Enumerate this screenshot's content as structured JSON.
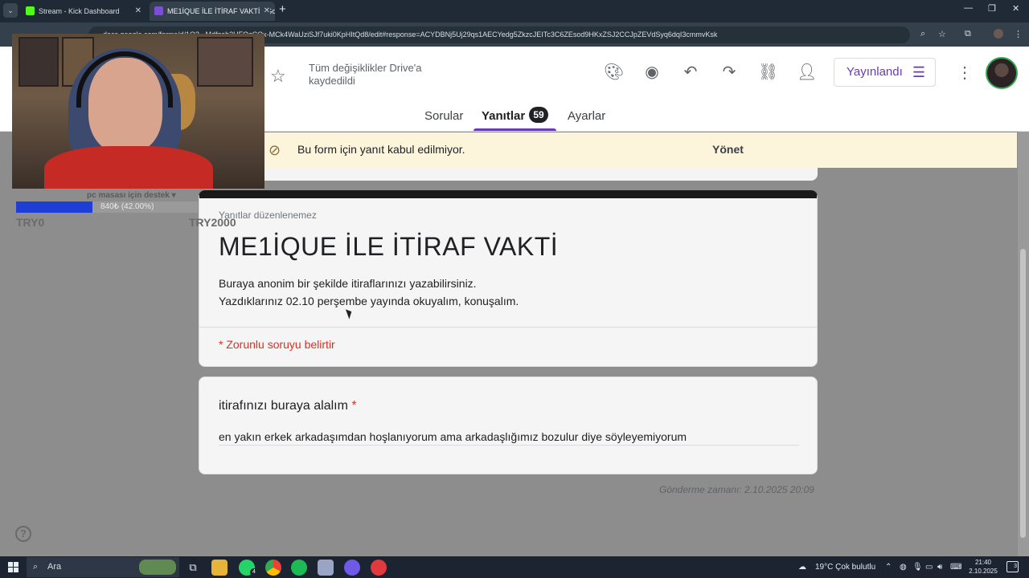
{
  "browser": {
    "tabs": [
      {
        "title": "Stream - Kick Dashboard",
        "favicon_color": "#53fc18"
      },
      {
        "title": "ME1İQUE İLE İTİRAF VAKTİ - Go",
        "favicon_color": "#7b4ed6"
      }
    ],
    "url": "docs.google.com/forms/d/1Q3...Mdfzab2UFQzCQx-MCk4WaUziSJf7uki0KpHItQd8/edit#response=ACYDBNj5Uj29qs1AECYedg5ZkzcJEITc3C6ZEsod9HKxZSJ2CCJpZEVdSyq6dqI3cmmvKsk"
  },
  "forms": {
    "saved_status": "Tüm değişiklikler Drive'a kaydedildi",
    "publish_label": "Yayınlandı",
    "tabs": {
      "questions": "Sorular",
      "responses": "Yanıtlar",
      "responses_count": "59",
      "settings": "Ayarlar"
    },
    "banner": {
      "text": "Bu form için yanıt kabul edilmiyor.",
      "action": "Yönet"
    },
    "header_card": {
      "edit_note": "Yanıtlar düzenlenemez",
      "title": "ME1İQUE İLE İTİRAF VAKTİ",
      "description_line1": "Buraya anonim bir şekilde itiraflarınızı yazabilirsiniz.",
      "description_line2": "Yazdıklarınız 02.10 perşembe yayında okuyalım, konuşalım.",
      "required_note": "* Zorunlu soruyu belirtir"
    },
    "question": {
      "title": "itirafınızı buraya alalım",
      "required_marker": "*",
      "answer": "en yakın erkek arkadaşımdan hoşlanıyorum ama arkadaşlığımız bozulur diye söyleyemiyorum"
    },
    "submitted_at": "Gönderme zamanı: 2.10.2025 20:09",
    "accent_color": "#673ab7"
  },
  "stream_overlay": {
    "donation_label": "pc masası için destek ▾",
    "donation_text": "840₺ (42.00%)",
    "donation_progress": 0.42,
    "goal_min": "TRY0",
    "goal_max": "TRY2000"
  },
  "taskbar": {
    "search_placeholder": "Ara",
    "whatsapp_badge": "4",
    "weather": "19°C  Çok bulutlu",
    "time": "21:40",
    "date": "2.10.2025",
    "notifications": "3"
  }
}
